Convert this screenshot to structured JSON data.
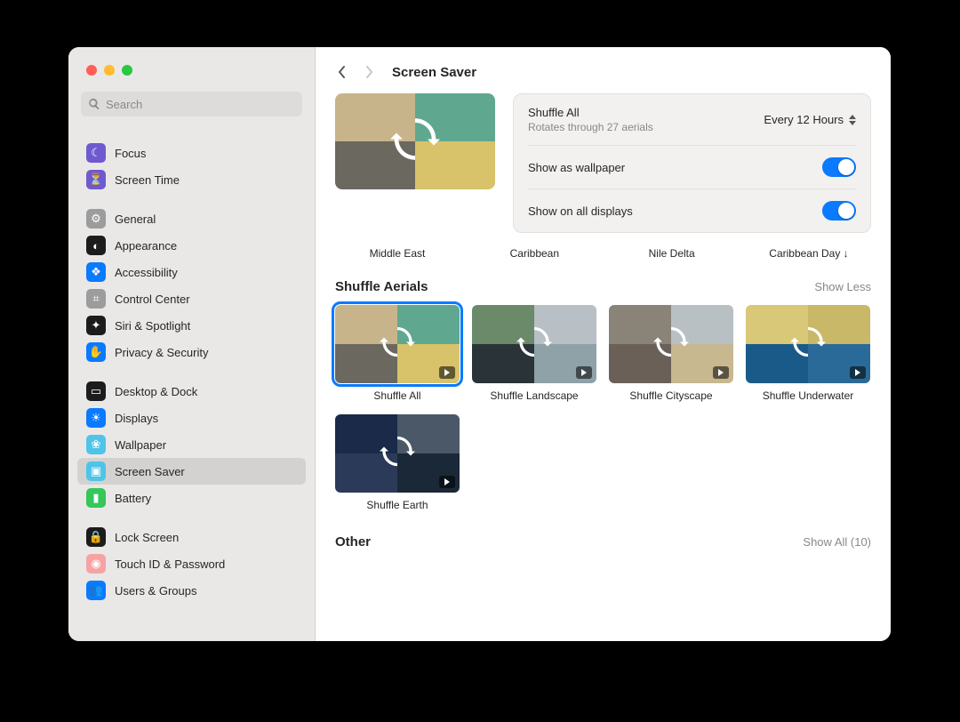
{
  "search": {
    "placeholder": "Search"
  },
  "sidebar": {
    "groups": [
      {
        "items": [
          {
            "label": "Focus",
            "bg": "#6e5acf",
            "glyph": "☾"
          },
          {
            "label": "Screen Time",
            "bg": "#6e5acf",
            "glyph": "⏳"
          }
        ]
      },
      {
        "items": [
          {
            "label": "General",
            "bg": "#9c9c9c",
            "glyph": "⚙"
          },
          {
            "label": "Appearance",
            "bg": "#1c1c1c",
            "glyph": "◐"
          },
          {
            "label": "Accessibility",
            "bg": "#0a7aff",
            "glyph": "❖"
          },
          {
            "label": "Control Center",
            "bg": "#9c9c9c",
            "glyph": "⌗"
          },
          {
            "label": "Siri & Spotlight",
            "bg": "#1c1c1c",
            "glyph": "✦"
          },
          {
            "label": "Privacy & Security",
            "bg": "#0a7aff",
            "glyph": "✋"
          }
        ]
      },
      {
        "items": [
          {
            "label": "Desktop & Dock",
            "bg": "#1c1c1c",
            "glyph": "▭"
          },
          {
            "label": "Displays",
            "bg": "#0a7aff",
            "glyph": "☀"
          },
          {
            "label": "Wallpaper",
            "bg": "#4fc3e8",
            "glyph": "❀"
          },
          {
            "label": "Screen Saver",
            "bg": "#4fc3e8",
            "glyph": "▣",
            "selected": true
          },
          {
            "label": "Battery",
            "bg": "#34c759",
            "glyph": "▮"
          }
        ]
      },
      {
        "items": [
          {
            "label": "Lock Screen",
            "bg": "#1c1c1c",
            "glyph": "🔒"
          },
          {
            "label": "Touch ID & Password",
            "bg": "#f5a3a3",
            "glyph": "◉"
          },
          {
            "label": "Users & Groups",
            "bg": "#0a7aff",
            "glyph": "👥"
          }
        ]
      }
    ]
  },
  "title": "Screen Saver",
  "hero": {
    "title": "Shuffle All",
    "subtitle": "Rotates through 27 aerials",
    "frequency": "Every 12 Hours",
    "rows": [
      {
        "label": "Show as wallpaper",
        "on": true
      },
      {
        "label": "Show on all displays",
        "on": true
      }
    ]
  },
  "peek": [
    "Middle East",
    "Caribbean",
    "Nile Delta",
    "Caribbean Day ↓"
  ],
  "section": {
    "title": "Shuffle Aerials",
    "action": "Show Less",
    "tiles": [
      {
        "label": "Shuffle All",
        "selected": true,
        "colors": [
          "#c8b48a",
          "#5fa88f",
          "#6b6860",
          "#d8c26a"
        ]
      },
      {
        "label": "Shuffle Landscape",
        "colors": [
          "#6a8a6a",
          "#b8bfc5",
          "#2a3438",
          "#8ea2a8"
        ]
      },
      {
        "label": "Shuffle Cityscape",
        "colors": [
          "#8a8478",
          "#b8c0c4",
          "#6a6058",
          "#c8b890"
        ]
      },
      {
        "label": "Shuffle Underwater",
        "colors": [
          "#d8c878",
          "#c8b868",
          "#1a5a88",
          "#2a6a98"
        ]
      },
      {
        "label": "Shuffle Earth",
        "colors": [
          "#1a2a48",
          "#4a5868",
          "#2a3a58",
          "#1a2838"
        ]
      }
    ]
  },
  "other": {
    "title": "Other",
    "action": "Show All (10)"
  }
}
